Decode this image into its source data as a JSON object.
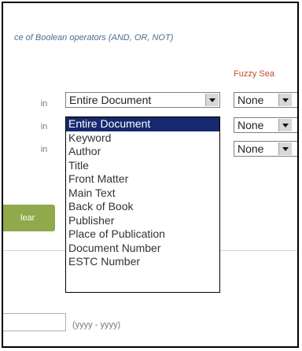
{
  "hint_text": "ce of Boolean operators (AND, OR, NOT)",
  "fuzzy_label": "Fuzzy Sea",
  "in_labels": [
    "in",
    "in",
    "in"
  ],
  "field_select": {
    "value": "Entire Document"
  },
  "fuzzy_selects": [
    {
      "value": "None"
    },
    {
      "value": "None"
    },
    {
      "value": "None"
    }
  ],
  "dropdown_options": [
    "Entire Document",
    "Keyword",
    "Author",
    "Title",
    "Front Matter",
    "Main Text",
    "Back of Book",
    "Publisher",
    "Place of Publication",
    "Document Number",
    "ESTC Number"
  ],
  "clear_label": "lear",
  "date_hint": "(yyyy - yyyy)",
  "colors": {
    "selected_option": "#16296e",
    "clear_button": "#8fa94b",
    "fuzzy_label": "#c04c28"
  }
}
